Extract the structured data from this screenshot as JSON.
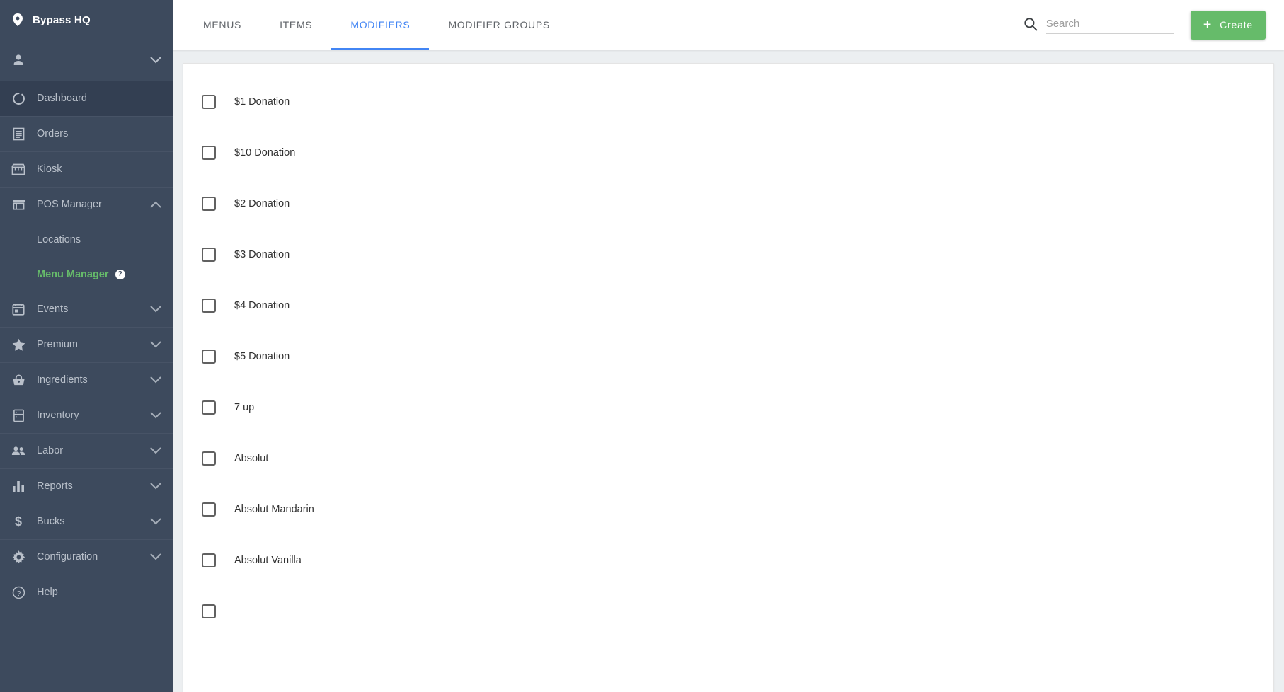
{
  "sidebar": {
    "brand": {
      "label": "Bypass HQ",
      "icon": "location-pin-icon"
    },
    "user": {
      "label": "",
      "icon": "person-icon",
      "chevron": "chevron-down-icon"
    },
    "items": [
      {
        "label": "Dashboard",
        "icon": "dashboard-loader-icon",
        "active": true,
        "chevron": ""
      },
      {
        "label": "Orders",
        "icon": "receipt-icon",
        "active": false,
        "chevron": ""
      },
      {
        "label": "Kiosk",
        "icon": "storefront-icon",
        "active": false,
        "chevron": ""
      },
      {
        "label": "POS Manager",
        "icon": "pos-store-icon",
        "active": false,
        "chevron": "chevron-up-icon"
      }
    ],
    "sub_items": [
      {
        "label": "Locations",
        "green": false,
        "badge": ""
      },
      {
        "label": "Menu Manager",
        "green": true,
        "badge": "?"
      }
    ],
    "items_after": [
      {
        "label": "Events",
        "icon": "calendar-icon",
        "chevron": "chevron-down-icon"
      },
      {
        "label": "Premium",
        "icon": "star-icon",
        "chevron": "chevron-down-icon"
      },
      {
        "label": "Ingredients",
        "icon": "basket-icon",
        "chevron": "chevron-down-icon"
      },
      {
        "label": "Inventory",
        "icon": "fridge-icon",
        "chevron": "chevron-down-icon"
      },
      {
        "label": "Labor",
        "icon": "people-icon",
        "chevron": "chevron-down-icon"
      },
      {
        "label": "Reports",
        "icon": "bar-chart-icon",
        "chevron": "chevron-down-icon"
      },
      {
        "label": "Bucks",
        "icon": "dollar-sign-icon",
        "chevron": "chevron-down-icon"
      },
      {
        "label": "Configuration",
        "icon": "gear-icon",
        "chevron": "chevron-down-icon"
      },
      {
        "label": "Help",
        "icon": "help-circle-icon",
        "chevron": ""
      }
    ]
  },
  "topbar": {
    "tabs": [
      {
        "label": "Menus",
        "active": false
      },
      {
        "label": "Items",
        "active": false
      },
      {
        "label": "Modifiers",
        "active": true
      },
      {
        "label": "Modifier Groups",
        "active": false
      }
    ],
    "search": {
      "placeholder": "Search",
      "value": "",
      "icon": "search-icon"
    },
    "create_label": "Create",
    "create_plus": "+",
    "create_color": "#66bb6a"
  },
  "list": {
    "rows": [
      {
        "label": "$1 Donation",
        "checked": false
      },
      {
        "label": "$10 Donation",
        "checked": false
      },
      {
        "label": "$2 Donation",
        "checked": false
      },
      {
        "label": "$3 Donation",
        "checked": false
      },
      {
        "label": "$4 Donation",
        "checked": false
      },
      {
        "label": "$5 Donation",
        "checked": false
      },
      {
        "label": "7 up",
        "checked": false
      },
      {
        "label": "Absolut",
        "checked": false
      },
      {
        "label": "Absolut Mandarin",
        "checked": false
      },
      {
        "label": "Absolut Vanilla",
        "checked": false
      },
      {
        "label": "",
        "checked": false
      }
    ]
  },
  "colors": {
    "sidebar_bg": "#3d4a5d",
    "sidebar_active": "#333f52",
    "accent_blue": "#4285f4",
    "accent_green": "#66bb6a",
    "page_bg": "#eceff1"
  }
}
